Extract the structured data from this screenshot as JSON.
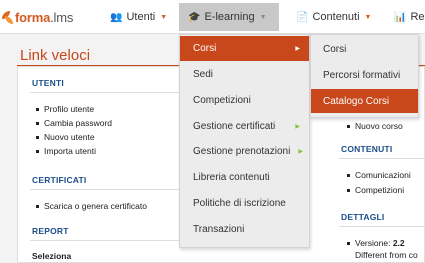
{
  "brand": {
    "prefix": "forma",
    "suffix": ".lms"
  },
  "nav": {
    "utenti": {
      "label": "Utenti",
      "icon": "users-icon"
    },
    "elearning": {
      "label": "E-learning",
      "icon": "graduation-cap-icon"
    },
    "contenuti": {
      "label": "Contenuti",
      "icon": "files-icon"
    },
    "rep": {
      "label": "Rep",
      "icon": "chart-icon"
    }
  },
  "page": {
    "title": "Link veloci"
  },
  "panel": {
    "utenti": {
      "heading": "UTENTI",
      "items": [
        "Profilo utente",
        "Cambia password",
        "Nuovo utente",
        "Importa utenti"
      ]
    },
    "certificati": {
      "heading": "CERTIFICATI",
      "items": [
        "Scarica o genera certificato"
      ]
    },
    "report": {
      "heading": "REPORT",
      "seleziona": "Seleziona"
    },
    "corsi_partial": {
      "item": "Nuovo corso"
    },
    "contenuti": {
      "heading": "CONTENUTI",
      "items": [
        "Comunicazioni",
        "Competizioni"
      ]
    },
    "dettagli": {
      "heading": "DETTAGLI",
      "versione_label": "Versione:",
      "versione_value": "2.2",
      "different": "Different from co"
    }
  },
  "elearning_menu": [
    {
      "label": "Corsi",
      "active": true,
      "has_submenu": true
    },
    {
      "label": "Sedi"
    },
    {
      "label": "Competizioni"
    },
    {
      "label": "Gestione certificati",
      "has_submenu": true
    },
    {
      "label": "Gestione prenotazioni",
      "has_submenu": true
    },
    {
      "label": "Libreria contenuti"
    },
    {
      "label": "Politiche di iscrizione"
    },
    {
      "label": "Transazioni"
    }
  ],
  "corsi_submenu": [
    {
      "label": "Corsi"
    },
    {
      "label": "Percorsi formativi"
    },
    {
      "label": "Catalogo Corsi",
      "active": true
    }
  ],
  "colors": {
    "accent": "#c8471b",
    "heading": "#1c4e8a",
    "menu_bg": "#ececec"
  }
}
